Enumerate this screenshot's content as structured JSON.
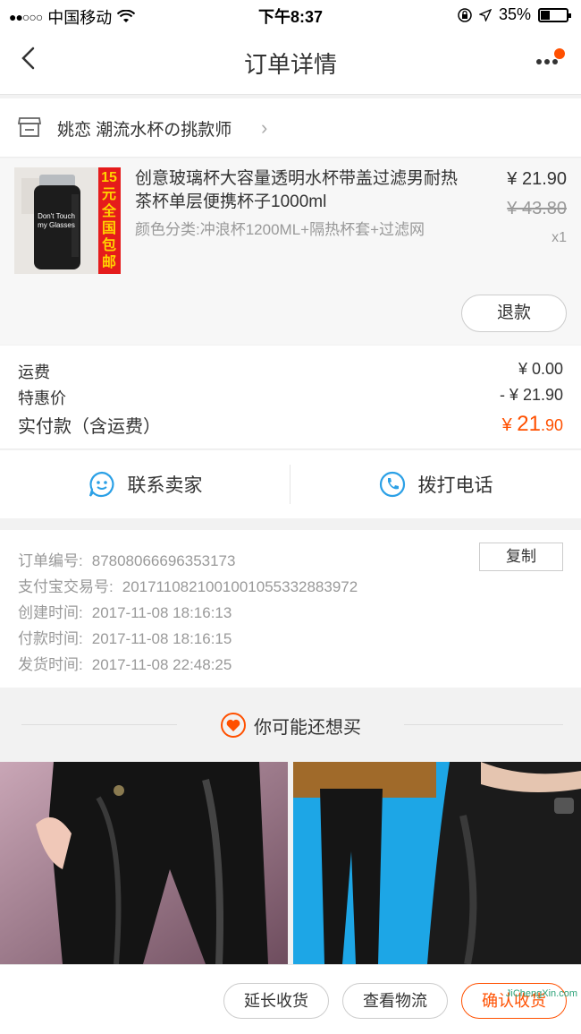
{
  "status": {
    "carrier": "中国移动",
    "time": "下午8:37",
    "battery": "35%"
  },
  "nav": {
    "title": "订单详情"
  },
  "shop": {
    "name": "姚恋 潮流水杯の挑款师"
  },
  "item": {
    "name": "创意玻璃杯大容量透明水杯带盖过滤男耐热茶杯单层便携杯子1000ml",
    "sku": "颜色分类:冲浪杯1200ML+隔热杯套+过滤网",
    "price": "¥ 21.90",
    "original_price": "¥ 43.80",
    "qty": "x1",
    "refund": "退款",
    "thumb_badge": "15元全国包邮",
    "bottle_text": "Don't Touch my Glasses"
  },
  "costs": {
    "shipping_label": "运费",
    "shipping_value": "¥ 0.00",
    "discount_label": "特惠价",
    "discount_value": "- ¥ 21.90",
    "total_label": "实付款（含运费）",
    "total_currency": "¥ ",
    "total_int": "21",
    "total_dec": ".90"
  },
  "contact": {
    "seller": "联系卖家",
    "call": "拨打电话"
  },
  "info": {
    "order_no_label": "订单编号:",
    "order_no": "87808066696353173",
    "alipay_label": "支付宝交易号:",
    "alipay": "2017110821001001055332883972",
    "created_label": "创建时间:",
    "created": "2017-11-08 18:16:13",
    "paid_label": "付款时间:",
    "paid": "2017-11-08 18:16:15",
    "shipped_label": "发货时间:",
    "shipped": "2017-11-08 22:48:25",
    "copy": "复制"
  },
  "guess": {
    "title": "你可能还想买"
  },
  "actions": {
    "extend": "延长收货",
    "logistics": "查看物流",
    "confirm": "确认收货"
  },
  "watermark": "JiChengXin.com",
  "colors": {
    "accent": "#ff5000",
    "blue": "#2ba0e6"
  }
}
